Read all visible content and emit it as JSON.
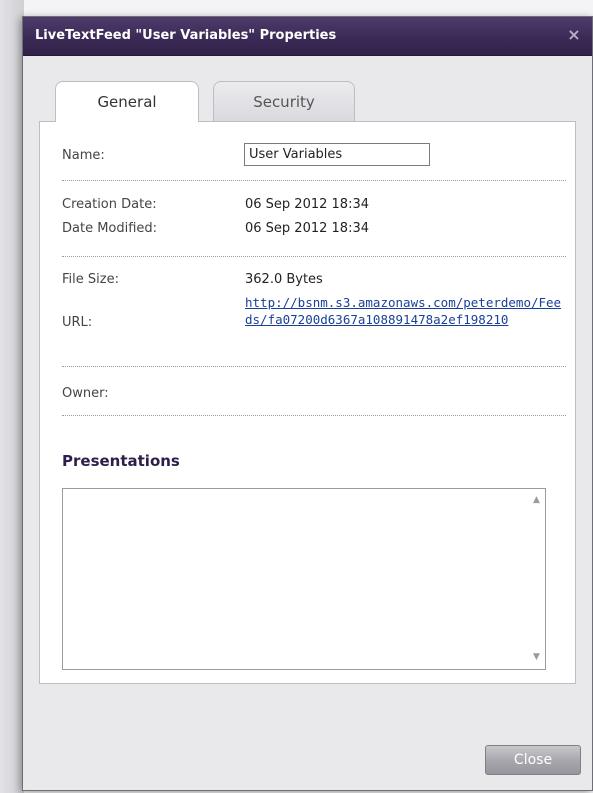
{
  "window": {
    "title": "LiveTextFeed \"User Variables\" Properties",
    "close_glyph": "×"
  },
  "tabs": [
    {
      "label": "General",
      "active": true
    },
    {
      "label": "Security",
      "active": false
    }
  ],
  "general": {
    "name_label": "Name:",
    "name_value": "User Variables",
    "creation_date_label": "Creation Date:",
    "creation_date_value": "06 Sep 2012 18:34",
    "date_modified_label": "Date Modified:",
    "date_modified_value": "06 Sep 2012 18:34",
    "file_size_label": "File Size:",
    "file_size_value": "362.0 Bytes",
    "url_label": "URL:",
    "url_value": "http://bsnm.s3.amazonaws.com/peterdemo/Feeds/fa07200d6367a108891478a2ef198210",
    "owner_label": "Owner:",
    "owner_value": ""
  },
  "presentations": {
    "heading": "Presentations",
    "items": [],
    "scroll_up_glyph": "▲",
    "scroll_down_glyph": "▼"
  },
  "footer": {
    "close_label": "Close"
  },
  "colors": {
    "titlebar": "#3b2a56",
    "heading": "#2d1f4a",
    "link": "#1a3f9a"
  }
}
